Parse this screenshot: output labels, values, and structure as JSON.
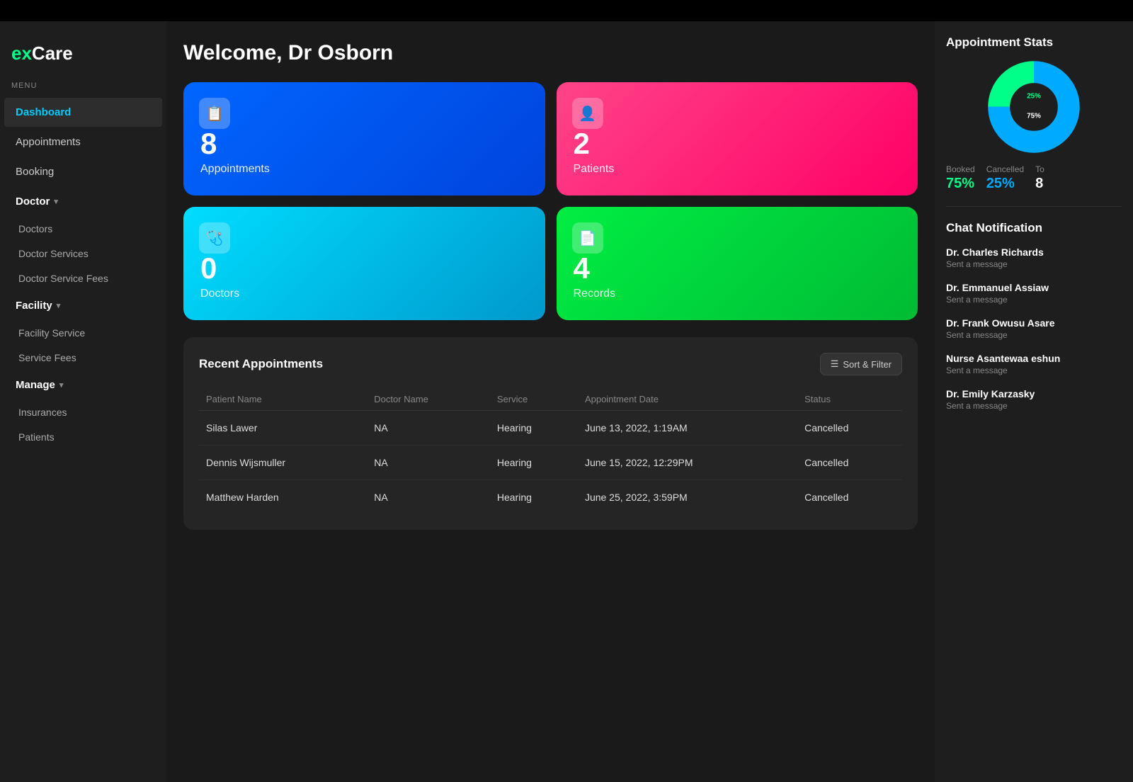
{
  "app": {
    "logo_prefix": "ex",
    "logo_suffix": "Care",
    "menu_label": "MENU"
  },
  "sidebar": {
    "items": [
      {
        "id": "dashboard",
        "label": "Dashboard",
        "active": true,
        "type": "item"
      },
      {
        "id": "appointments",
        "label": "Appointments",
        "active": false,
        "type": "item"
      },
      {
        "id": "booking",
        "label": "Booking",
        "active": false,
        "type": "item"
      },
      {
        "id": "doctor",
        "label": "Doctor",
        "active": false,
        "type": "section"
      },
      {
        "id": "doctors",
        "label": "Doctors",
        "active": false,
        "type": "sub"
      },
      {
        "id": "doctor-services",
        "label": "Doctor Services",
        "active": false,
        "type": "sub"
      },
      {
        "id": "doctor-service-fees",
        "label": "Doctor Service Fees",
        "active": false,
        "type": "sub"
      },
      {
        "id": "facility",
        "label": "Facility",
        "active": false,
        "type": "section"
      },
      {
        "id": "facility-service",
        "label": "Facility Service",
        "active": false,
        "type": "sub"
      },
      {
        "id": "service-fees",
        "label": "Service Fees",
        "active": false,
        "type": "sub"
      },
      {
        "id": "manage",
        "label": "Manage",
        "active": false,
        "type": "section"
      },
      {
        "id": "insurances",
        "label": "Insurances",
        "active": false,
        "type": "sub"
      },
      {
        "id": "patients",
        "label": "Patients",
        "active": false,
        "type": "sub"
      }
    ]
  },
  "header": {
    "welcome_text": "Welcome, Dr Osborn"
  },
  "stat_cards": [
    {
      "id": "appointments",
      "number": "8",
      "label": "Appointments",
      "icon": "📋",
      "color_class": "card-appointments"
    },
    {
      "id": "patients",
      "number": "2",
      "label": "Patients",
      "icon": "👤",
      "color_class": "card-patients"
    },
    {
      "id": "doctors",
      "number": "0",
      "label": "Doctors",
      "icon": "🩺",
      "color_class": "card-doctors"
    },
    {
      "id": "records",
      "number": "4",
      "label": "Records",
      "icon": "📄",
      "color_class": "card-records"
    }
  ],
  "recent_appointments": {
    "title": "Recent Appointments",
    "sort_button_label": "Sort & Filter",
    "columns": [
      "Patient Name",
      "Doctor Name",
      "Service",
      "Appointment Date",
      "Status"
    ],
    "rows": [
      {
        "patient_name": "Silas Lawer",
        "doctor_name": "NA",
        "service": "Hearing",
        "date": "June 13, 2022, 1:19AM",
        "status": "Cancelled"
      },
      {
        "patient_name": "Dennis Wijsmuller",
        "doctor_name": "NA",
        "service": "Hearing",
        "date": "June 15, 2022, 12:29PM",
        "status": "Cancelled"
      },
      {
        "patient_name": "Matthew Harden",
        "doctor_name": "NA",
        "service": "Hearing",
        "date": "June 25, 2022, 3:59PM",
        "status": "Cancelled"
      }
    ]
  },
  "appointment_stats": {
    "title": "Appointment Stats",
    "booked_pct": "75%",
    "cancelled_pct": "25%",
    "total": "8",
    "booked_label": "Booked",
    "cancelled_label": "Cancelled",
    "total_label": "To",
    "pie_booked_color": "#00aaff",
    "pie_cancelled_color": "#00ff88"
  },
  "chat_notification": {
    "title": "Chat Notification",
    "messages": [
      {
        "name": "Dr. Charles Richards",
        "preview": "Sent a message"
      },
      {
        "name": "Dr. Emmanuel Assiaw",
        "preview": "Sent a message"
      },
      {
        "name": "Dr. Frank Owusu Asare",
        "preview": "Sent a message"
      },
      {
        "name": "Nurse Asantewaa eshun",
        "preview": "Sent a message"
      },
      {
        "name": "Dr. Emily Karzasky",
        "preview": "Sent a message"
      }
    ]
  }
}
